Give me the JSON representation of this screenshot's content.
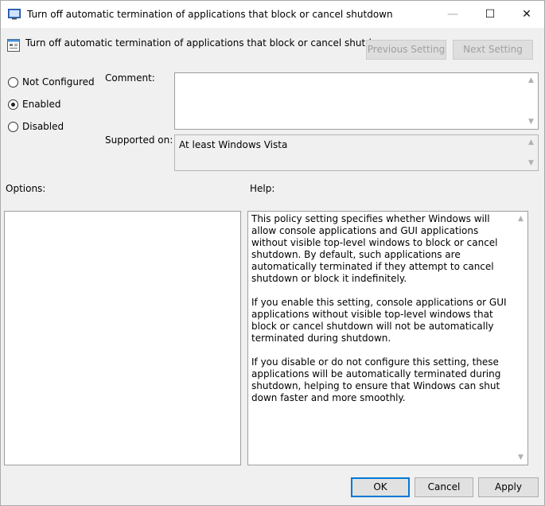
{
  "window": {
    "title": "Turn off automatic termination of applications that block or cancel shutdown",
    "controls": {
      "minimize": "—",
      "maximize": "☐",
      "close": "✕"
    }
  },
  "header": {
    "setting_title": "Turn off automatic termination of applications that block or cancel shutdown",
    "previous_label": "Previous Setting",
    "next_label": "Next Setting"
  },
  "state": {
    "options": [
      {
        "label": "Not Configured",
        "selected": false
      },
      {
        "label": "Enabled",
        "selected": true
      },
      {
        "label": "Disabled",
        "selected": false
      }
    ]
  },
  "comment": {
    "label": "Comment:",
    "value": ""
  },
  "supported": {
    "label": "Supported on:",
    "value": "At least Windows Vista"
  },
  "options_section": {
    "label": "Options:"
  },
  "help": {
    "label": "Help:",
    "paragraphs": [
      "This policy setting specifies whether Windows will allow console applications and GUI applications without visible top-level windows to block or cancel shutdown. By default, such applications are automatically terminated if they attempt to cancel shutdown or block it indefinitely.",
      "If you enable this setting, console applications or GUI applications without visible top-level windows that block or cancel shutdown will not be automatically terminated during shutdown.",
      "If you disable or do not configure this setting, these applications will be automatically terminated during shutdown, helping to ensure that Windows can shut down faster and more smoothly."
    ]
  },
  "footer": {
    "ok": "OK",
    "cancel": "Cancel",
    "apply": "Apply"
  },
  "icons": {
    "app": "policy-window-icon",
    "setting": "policy-setting-icon"
  }
}
